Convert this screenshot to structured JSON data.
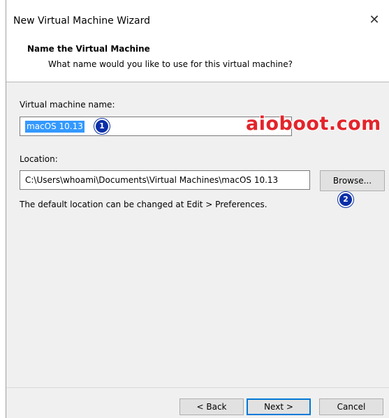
{
  "window": {
    "title": "New Virtual Machine Wizard",
    "close_glyph": "✕"
  },
  "header": {
    "title": "Name the Virtual Machine",
    "subtitle": "What name would you like to use for this virtual machine?"
  },
  "form": {
    "name_label": "Virtual machine name:",
    "name_value": "macOS 10.13",
    "location_label": "Location:",
    "location_value": "C:\\Users\\whoami\\Documents\\Virtual Machines\\macOS 10.13",
    "browse_label": "Browse...",
    "hint": "The default location can be changed at Edit > Preferences."
  },
  "annotations": {
    "watermark": "aioboot.com",
    "badge_1": "1",
    "badge_2": "2",
    "badge_color": "#0a2fa8",
    "watermark_color": "#e3242b"
  },
  "footer": {
    "back_label": "< Back",
    "next_label": "Next >",
    "cancel_label": "Cancel"
  },
  "colors": {
    "selection": "#3399ff",
    "default_button_border": "#0078d7",
    "dialog_background": "#f0f0f0"
  }
}
